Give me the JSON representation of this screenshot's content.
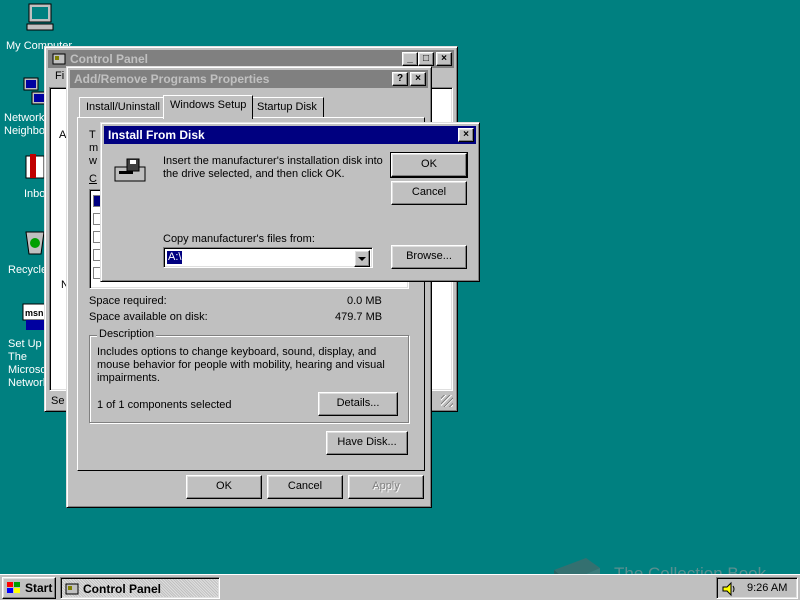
{
  "desktop": {
    "icons": [
      {
        "label": "My Computer",
        "icon": "computer-icon"
      },
      {
        "label": "Network Neighborhood",
        "icon": "network-icon"
      },
      {
        "label": "Inbox",
        "icon": "inbox-icon"
      },
      {
        "label": "Recycle Bin",
        "icon": "recycle-bin-icon"
      },
      {
        "label": "Set Up The Microsoft Network",
        "icon": "msn-icon"
      }
    ],
    "watermark": "The Collection Book"
  },
  "control_panel": {
    "title": "Control Panel",
    "menu_first": "Fi",
    "left_letters": [
      "A",
      "N"
    ],
    "status_prefix": "Se"
  },
  "properties": {
    "title": "Add/Remove Programs Properties",
    "tabs": [
      "Install/Uninstall",
      "Windows Setup",
      "Startup Disk"
    ],
    "partial_text": [
      "T",
      "m",
      "w",
      "C"
    ],
    "space_required_label": "Space required:",
    "space_required_value": "0.0 MB",
    "space_available_label": "Space available on disk:",
    "space_available_value": "479.7 MB",
    "description_label": "Description",
    "description_text": "Includes options to change keyboard, sound, display, and mouse behavior for people with mobility, hearing and visual impairments.",
    "components_selected": "1 of 1 components selected",
    "details_button": "Details...",
    "have_disk_button": "Have Disk...",
    "ok_button": "OK",
    "cancel_button": "Cancel",
    "apply_button": "Apply"
  },
  "install_dialog": {
    "title": "Install From Disk",
    "instructions": "Insert the manufacturer's installation disk into the drive selected, and then click OK.",
    "copy_label": "Copy manufacturer's files from:",
    "copy_value": "A:\\",
    "ok_button": "OK",
    "cancel_button": "Cancel",
    "browse_button": "Browse..."
  },
  "taskbar": {
    "start_label": "Start",
    "task_label": "Control Panel",
    "clock": "9:26 AM"
  }
}
